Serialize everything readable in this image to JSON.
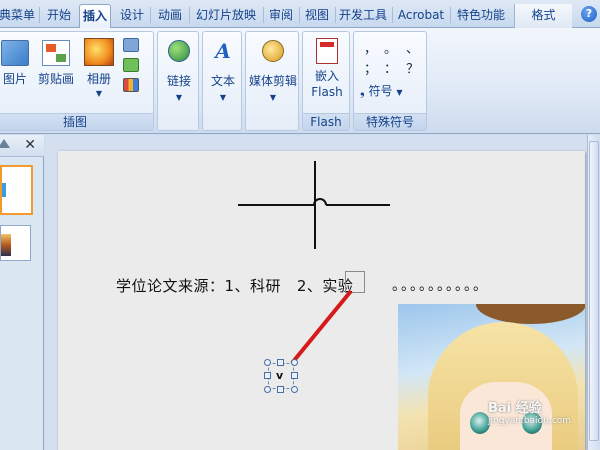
{
  "tabs": [
    {
      "label": "典菜单"
    },
    {
      "label": "开始"
    },
    {
      "label": "插入",
      "active": true
    },
    {
      "label": "设计"
    },
    {
      "label": "动画"
    },
    {
      "label": "幻灯片放映"
    },
    {
      "label": "审阅"
    },
    {
      "label": "视图"
    },
    {
      "label": "开发工具"
    },
    {
      "label": "Acrobat"
    },
    {
      "label": "特色功能"
    },
    {
      "label": "格式"
    }
  ],
  "help_label": "?",
  "ribbon": {
    "illustrations": {
      "group_label": "插图",
      "picture_label": "图片",
      "clipart_label": "剪贴画",
      "album_label": "相册",
      "album_arrow": "▼"
    },
    "links": {
      "button_label": "链接",
      "arrow": "▼"
    },
    "text": {
      "button_label": "文本",
      "arrow": "▼"
    },
    "media": {
      "button_label": "媒体剪辑",
      "arrow": "▼"
    },
    "flash": {
      "group_label": "Flash",
      "button_line1": "嵌入",
      "button_line2": "Flash"
    },
    "special_symbols": {
      "group_label": "特殊符号",
      "symbols": [
        "，",
        "。",
        "、",
        "；",
        "：",
        "？"
      ],
      "symbol_button_label": "符号",
      "symbol_prefix": "❟",
      "arrow": "▼"
    }
  },
  "left_pane": {
    "close_label": "✕"
  },
  "slide": {
    "source_text": "学位论文来源：1、科研   2、实验",
    "dots_text": "。。。。。。。。。。",
    "textbox_char": "v",
    "watermark_brand": "Bai 经验",
    "watermark_url": "jingyan.baidu.com"
  },
  "colors": {
    "red_connector": "#d61a1a",
    "active_thumb_border": "#f29a2e",
    "ribbon_text": "#15428b"
  }
}
